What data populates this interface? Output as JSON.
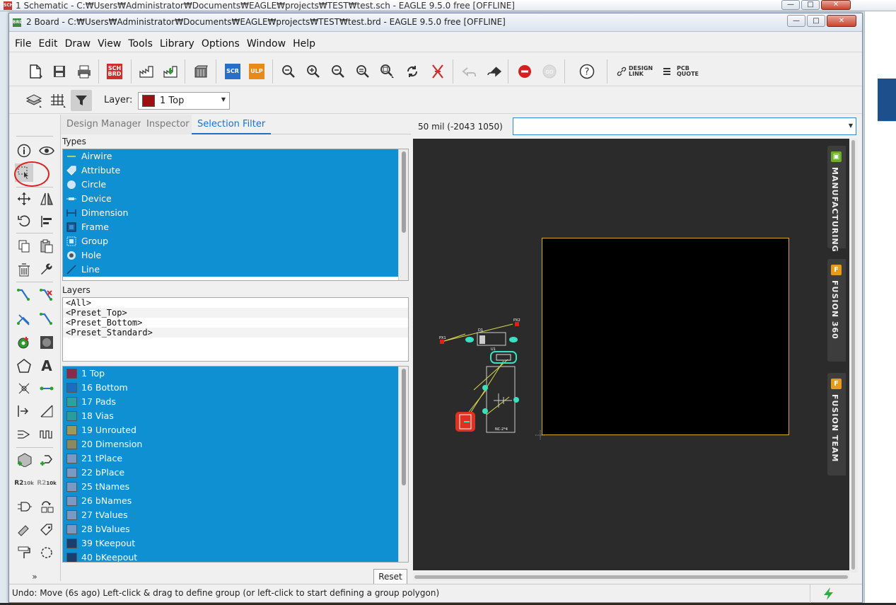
{
  "background_window": {
    "title": "1 Schematic - C:₩Users₩Administrator₩Documents₩EAGLE₩projects₩TEST₩test.sch - EAGLE 9.5.0 free [OFFLINE]",
    "icon_text": "SCH"
  },
  "window": {
    "title": "2 Board - C:₩Users₩Administrator₩Documents₩EAGLE₩projects₩TEST₩test.brd - EAGLE 9.5.0 free [OFFLINE]",
    "icon_text": "BRD",
    "controls": {
      "minimize": "—",
      "maximize": "□",
      "close": "✕"
    }
  },
  "menu": [
    "File",
    "Edit",
    "Draw",
    "View",
    "Tools",
    "Library",
    "Options",
    "Window",
    "Help"
  ],
  "toolbar": {
    "sch_brd": "SCH\nBRD",
    "scr": "SCR",
    "ulp": "ULP",
    "design_link": "DESIGN\nLINK",
    "pcb_quote": "PCB\nQUOTE"
  },
  "layer_bar": {
    "label": "Layer:",
    "value": "1 Top",
    "swatch_color": "#9e0f12"
  },
  "tabs": [
    {
      "label": "Design Manager"
    },
    {
      "label": "Inspector"
    },
    {
      "label": "Selection Filter"
    }
  ],
  "types": {
    "label": "Types",
    "items": [
      "Airwire",
      "Attribute",
      "Circle",
      "Device",
      "Dimension",
      "Frame",
      "Group",
      "Hole",
      "Line"
    ]
  },
  "layers": {
    "label": "Layers",
    "presets": [
      "<All>",
      "<Preset_Top>",
      "<Preset_Bottom>",
      "<Preset_Standard>"
    ],
    "items": [
      {
        "name": "1 Top",
        "color": "#8a2a4a"
      },
      {
        "name": "16 Bottom",
        "color": "#1a6ec0"
      },
      {
        "name": "17 Pads",
        "color": "#2aa3a0"
      },
      {
        "name": "18 Vias",
        "color": "#2a9ca0"
      },
      {
        "name": "19 Unrouted",
        "color": "#9a9a5a"
      },
      {
        "name": "20 Dimension",
        "color": "#8a8a60"
      },
      {
        "name": "21 tPlace",
        "color": "#7a9ac4"
      },
      {
        "name": "22 bPlace",
        "color": "#7a9ac4"
      },
      {
        "name": "25 tNames",
        "color": "#7a9ac4"
      },
      {
        "name": "26 bNames",
        "color": "#7a9ac4"
      },
      {
        "name": "27 tValues",
        "color": "#7a9ac4"
      },
      {
        "name": "28 bValues",
        "color": "#7a9ac4"
      },
      {
        "name": "39 tKeepout",
        "color": "#1a3f6e"
      },
      {
        "name": "40 bKeepout",
        "color": "#1a3f6e"
      }
    ]
  },
  "reset_label": "Reset",
  "coordinate": "50 mil (-2043 1050)",
  "command_input": "",
  "side_tabs": [
    {
      "label": "MANUFACTURING",
      "icon": "▣",
      "color": "#6ab02a"
    },
    {
      "label": "FUSION 360",
      "icon": "F",
      "color": "#e89a1a"
    },
    {
      "label": "FUSION TEAM",
      "icon": "F",
      "color": "#e89a1a"
    }
  ],
  "components": {
    "u1_label": "U1",
    "d1_label": "D1",
    "ic1_label": "NC-2*4",
    "pads": [
      "PX1",
      "PX2"
    ]
  },
  "status": {
    "text": "Undo: Move (6s ago) Left-click & drag to define group (or left-click to start defining a group polygon)"
  },
  "colors": {
    "selection": "#0e90d2",
    "accent": "#1d6fc7",
    "canvas_bg": "#2b2b2b",
    "board_outline": "#d4aa20",
    "highlight": "#e02020"
  }
}
